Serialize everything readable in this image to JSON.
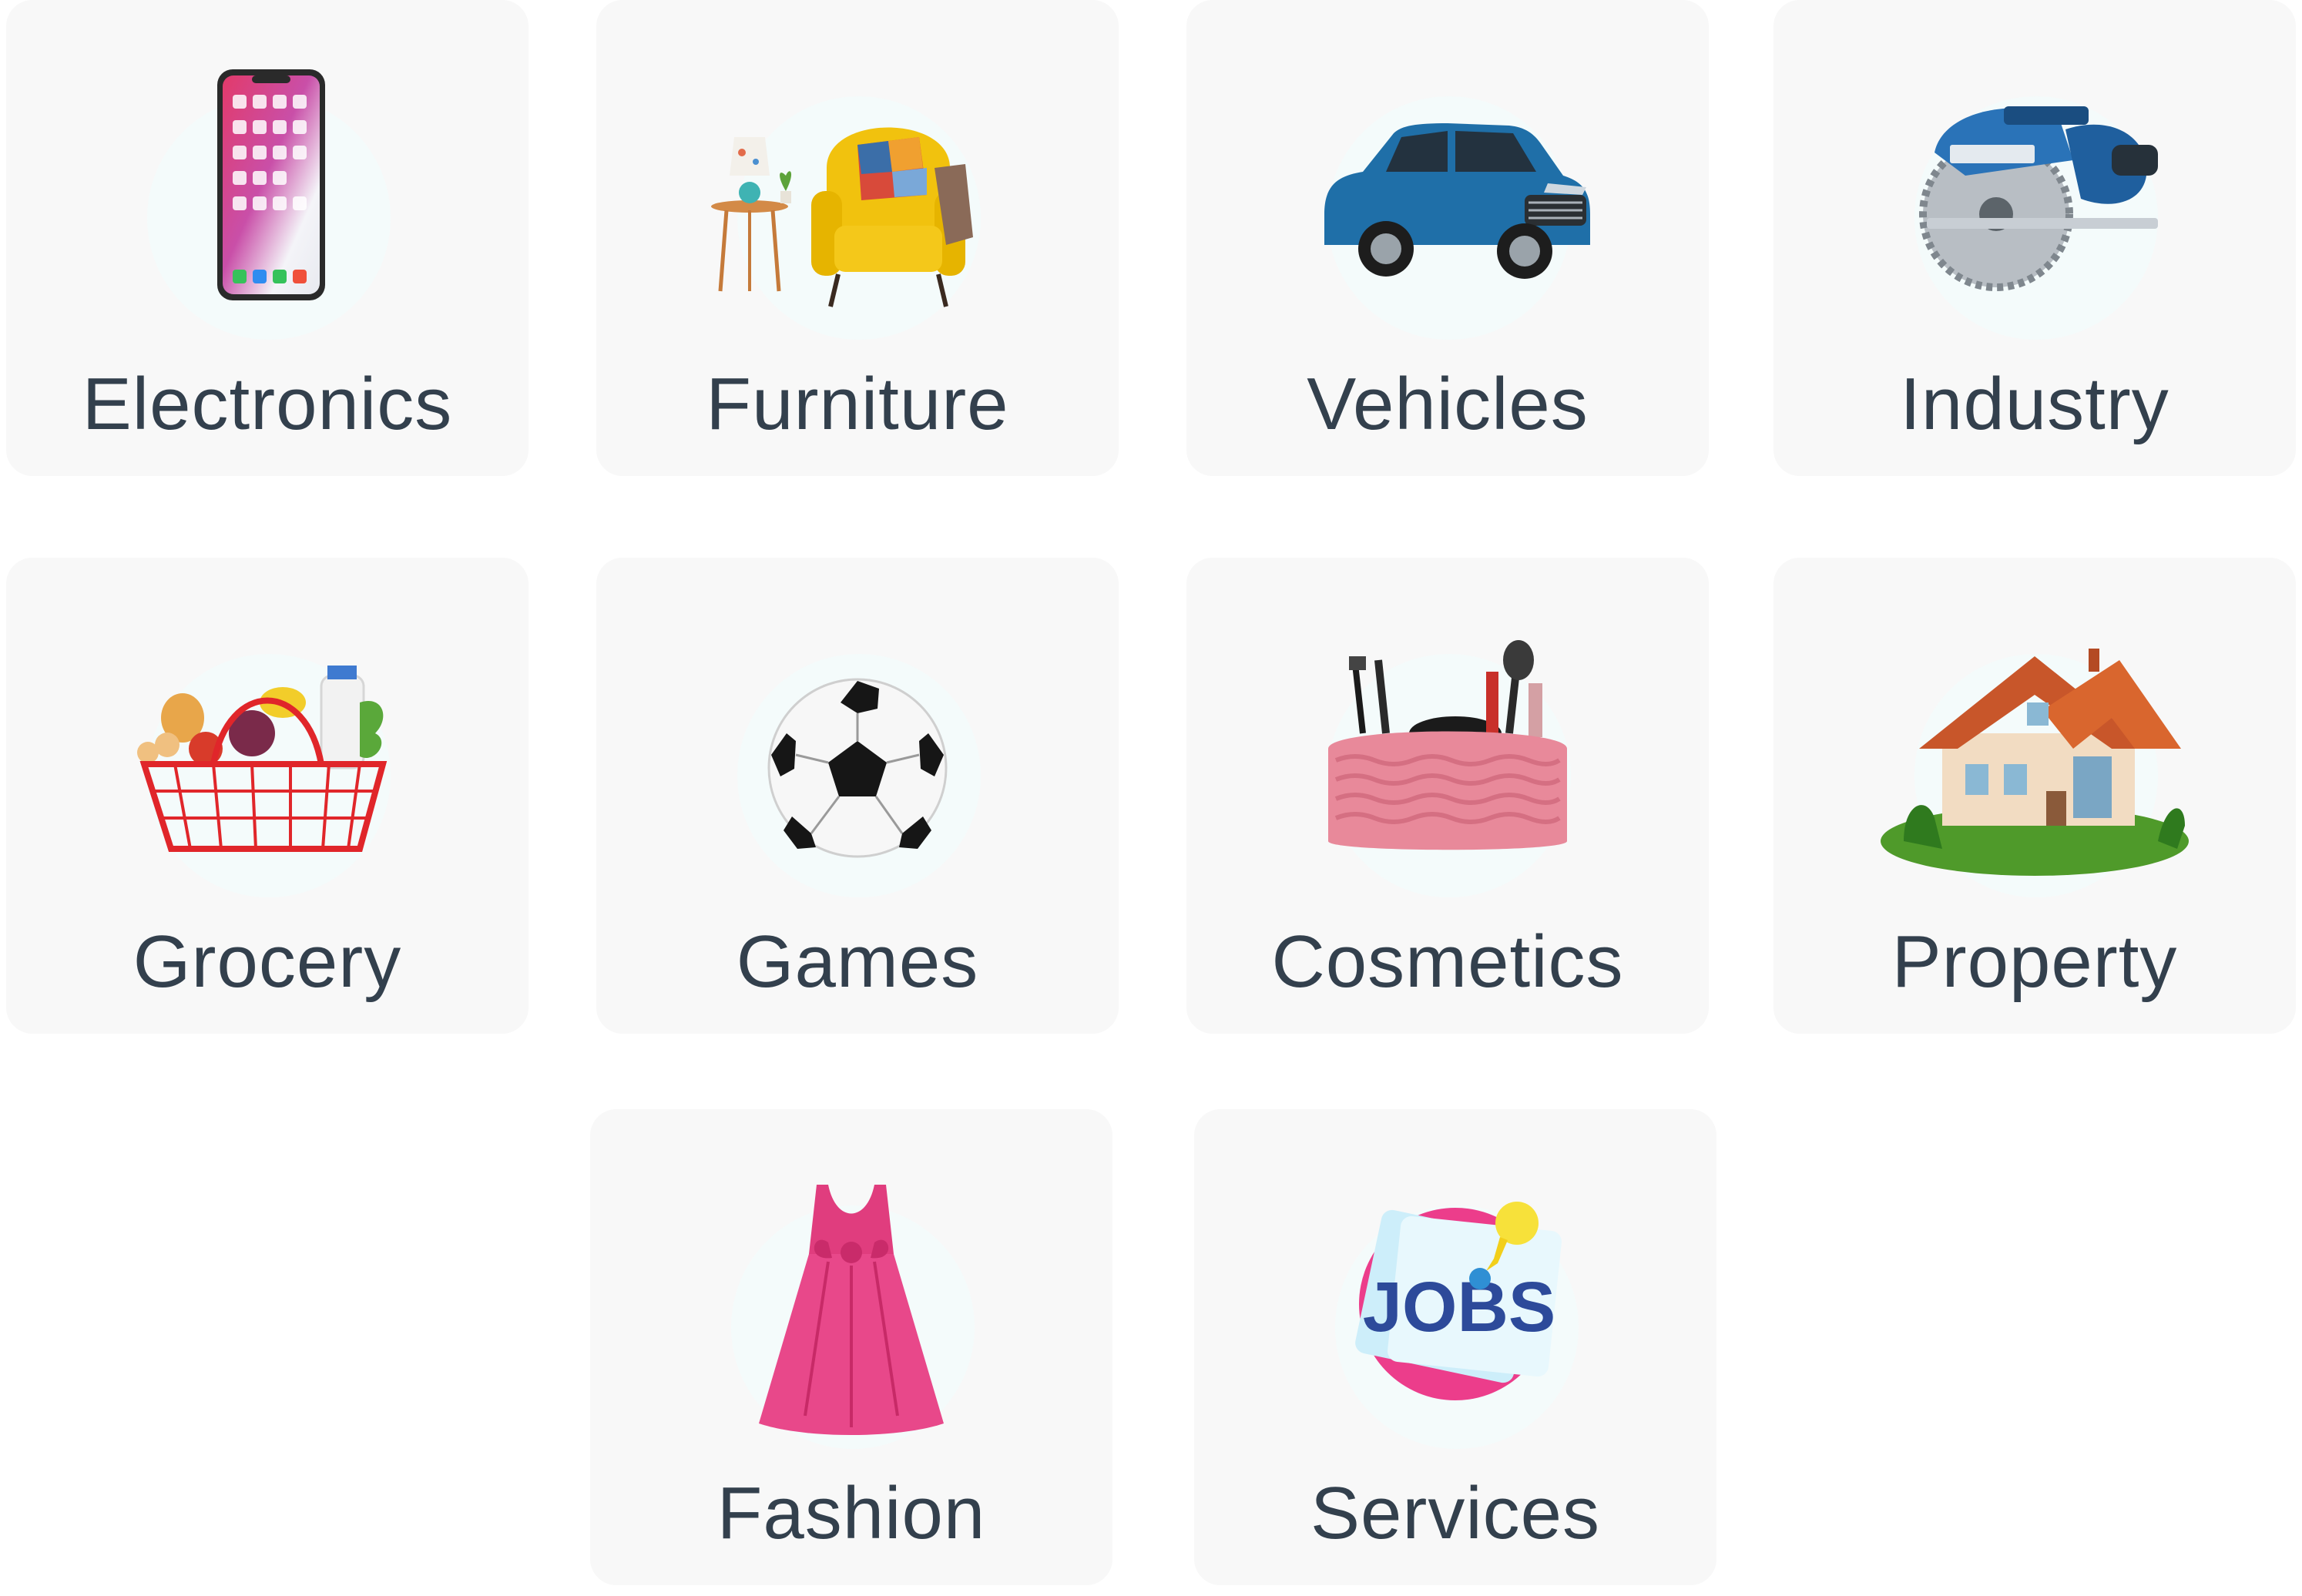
{
  "categories": [
    {
      "id": "electronics",
      "label": "Electronics",
      "icon": "smartphone-icon"
    },
    {
      "id": "furniture",
      "label": "Furniture",
      "icon": "armchair-icon"
    },
    {
      "id": "vehicles",
      "label": "Vehicles",
      "icon": "car-icon"
    },
    {
      "id": "industry",
      "label": "Industry",
      "icon": "circular-saw-icon"
    },
    {
      "id": "grocery",
      "label": "Grocery",
      "icon": "grocery-basket-icon"
    },
    {
      "id": "games",
      "label": "Games",
      "icon": "soccer-ball-icon"
    },
    {
      "id": "cosmetics",
      "label": "Cosmetics",
      "icon": "makeup-bag-icon"
    },
    {
      "id": "property",
      "label": "Property",
      "icon": "house-icon"
    },
    {
      "id": "fashion",
      "label": "Fashion",
      "icon": "dress-icon"
    },
    {
      "id": "services",
      "label": "Services",
      "icon": "jobs-note-icon",
      "icon_text": "JOBS"
    }
  ],
  "colors": {
    "card_background": "#f8f8f8",
    "label_text": "#33404d",
    "halo": "#f4fbfb"
  }
}
